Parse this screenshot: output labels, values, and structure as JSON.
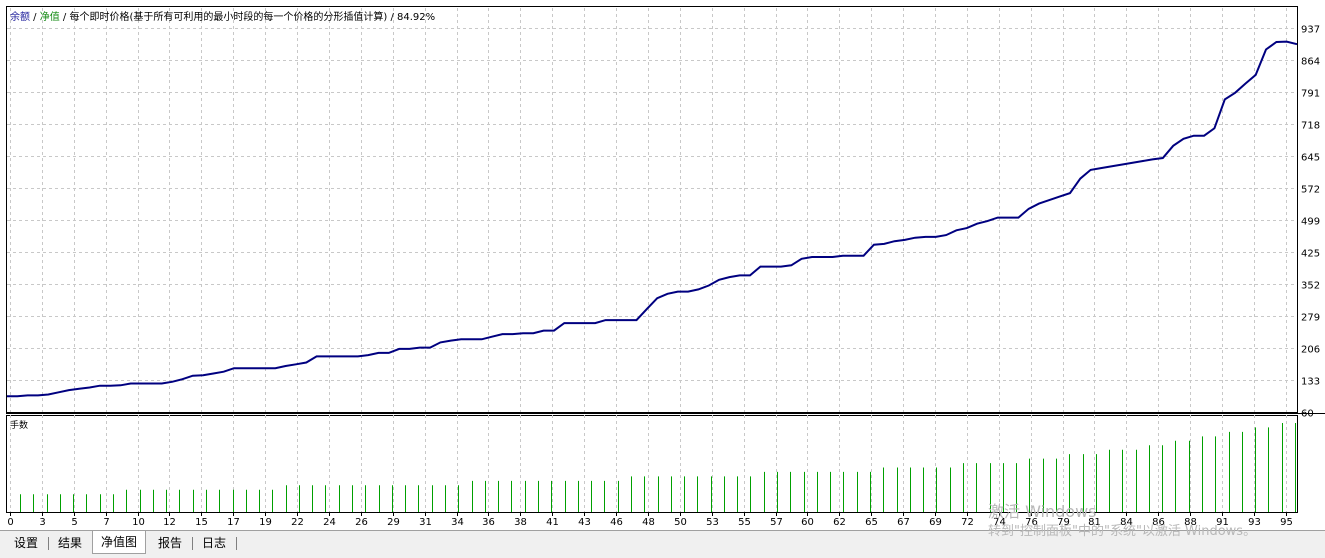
{
  "header": {
    "balance_label": "余额",
    "sep1": " / ",
    "equity_label": "净值",
    "sep2": " / ",
    "model_text": "每个即时价格(基于所有可利用的最小时段的每一个价格的分形插值计算)",
    "sep3": " / ",
    "quality": "84.92%"
  },
  "sub_chart_label": "手数",
  "y_axis_ticks": [
    "937",
    "864",
    "791",
    "718",
    "645",
    "572",
    "499",
    "425",
    "352",
    "279",
    "206",
    "133",
    "60"
  ],
  "x_axis_ticks": [
    "0",
    "3",
    "5",
    "7",
    "10",
    "12",
    "15",
    "17",
    "19",
    "22",
    "24",
    "26",
    "29",
    "31",
    "34",
    "36",
    "38",
    "41",
    "43",
    "46",
    "48",
    "50",
    "53",
    "55",
    "57",
    "60",
    "62",
    "65",
    "67",
    "69",
    "72",
    "74",
    "76",
    "79",
    "81",
    "84",
    "86",
    "88",
    "91",
    "93",
    "95"
  ],
  "tabs": [
    {
      "label": "设置",
      "active": false
    },
    {
      "label": "结果",
      "active": false
    },
    {
      "label": "净值图",
      "active": true
    },
    {
      "label": "报告",
      "active": false
    },
    {
      "label": "日志",
      "active": false
    }
  ],
  "watermark": {
    "line1": "激活 Windows",
    "line2": "转到\"控制面板\"中的\"系统\"以激活 Windows。"
  },
  "colors": {
    "balance_line": "#000080",
    "lot_bars": "#00a000",
    "grid": "#c8c8c8"
  },
  "chart_data": {
    "type": "line",
    "series": [
      {
        "name": "余额",
        "values": [
          96,
          96,
          98,
          98,
          100,
          105,
          110,
          113,
          116,
          120,
          120,
          121,
          125,
          125,
          125,
          125,
          129,
          135,
          143,
          144,
          148,
          152,
          160,
          160,
          160,
          160,
          160,
          165,
          169,
          173,
          187,
          187,
          187,
          187,
          187,
          190,
          195,
          195,
          204,
          204,
          207,
          207,
          219,
          223,
          226,
          226,
          226,
          232,
          238,
          238,
          240,
          240,
          246,
          246,
          263,
          263,
          263,
          263,
          270,
          270,
          270,
          270,
          295,
          320,
          330,
          335,
          335,
          340,
          349,
          362,
          368,
          372,
          372,
          392,
          392,
          392,
          395,
          410,
          414,
          414,
          414,
          417,
          417,
          417,
          442,
          444,
          450,
          453,
          458,
          460,
          460,
          464,
          475,
          480,
          490,
          496,
          504,
          504,
          504,
          524,
          536,
          544,
          552,
          560,
          593,
          613,
          617,
          621,
          625,
          629,
          633,
          637,
          640,
          668,
          684,
          691,
          691,
          708,
          774,
          789,
          810,
          830,
          888,
          905,
          906,
          900
        ]
      }
    ],
    "lots": [
      0.2,
      0.2,
      0.2,
      0.2,
      0.2,
      0.2,
      0.2,
      0.2,
      0.25,
      0.25,
      0.25,
      0.25,
      0.25,
      0.25,
      0.25,
      0.25,
      0.25,
      0.25,
      0.25,
      0.25,
      0.3,
      0.3,
      0.3,
      0.3,
      0.3,
      0.3,
      0.3,
      0.3,
      0.3,
      0.3,
      0.3,
      0.3,
      0.3,
      0.3,
      0.35,
      0.35,
      0.35,
      0.35,
      0.35,
      0.35,
      0.35,
      0.35,
      0.35,
      0.35,
      0.35,
      0.35,
      0.4,
      0.4,
      0.4,
      0.4,
      0.4,
      0.4,
      0.4,
      0.4,
      0.4,
      0.4,
      0.45,
      0.45,
      0.45,
      0.45,
      0.45,
      0.45,
      0.45,
      0.45,
      0.45,
      0.5,
      0.5,
      0.5,
      0.5,
      0.5,
      0.5,
      0.55,
      0.55,
      0.55,
      0.55,
      0.55,
      0.6,
      0.6,
      0.6,
      0.65,
      0.65,
      0.65,
      0.7,
      0.7,
      0.7,
      0.75,
      0.75,
      0.8,
      0.8,
      0.85,
      0.85,
      0.9,
      0.9,
      0.95,
      0.95,
      1.0,
      1.0
    ],
    "ylim": [
      60,
      937
    ]
  }
}
